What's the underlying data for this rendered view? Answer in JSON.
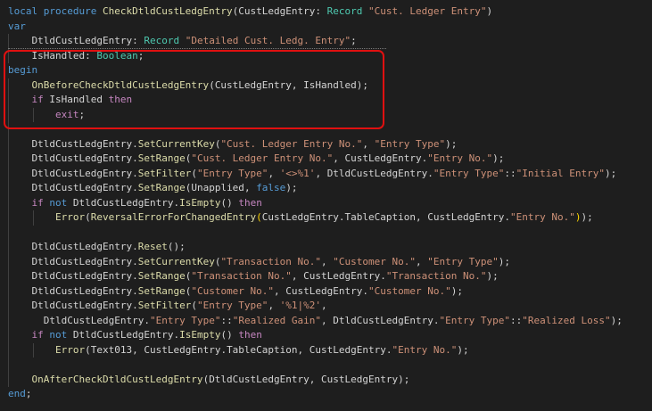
{
  "code": {
    "l01": {
      "a": "local procedure ",
      "b": "CheckDtldCustLedgEntry",
      "c": "(",
      "d": "CustLedgEntry",
      "e": ": ",
      "f": "Record",
      "g": " ",
      "h": "\"Cust. Ledger Entry\"",
      "i": ")"
    },
    "l02": {
      "a": "var"
    },
    "l03": {
      "a": "    ",
      "b": "DtldCustLedgEntry",
      "c": ": ",
      "d": "Record",
      "e": " ",
      "f": "\"Detailed Cust. Ledg. Entry\"",
      "g": ";"
    },
    "l04": {
      "a": "    ",
      "b": "IsHandled",
      "c": ": ",
      "d": "Boolean",
      "e": ";"
    },
    "l05": {
      "a": "begin"
    },
    "l06": {
      "a": "    ",
      "b": "OnBeforeCheckDtldCustLedgEntry",
      "c": "(",
      "d": "CustLedgEntry",
      "e": ", ",
      "f": "IsHandled",
      "g": ");"
    },
    "l07": {
      "a": "    ",
      "b": "if",
      "c": " ",
      "d": "IsHandled",
      "e": " ",
      "f": "then"
    },
    "l08": {
      "a": "        ",
      "b": "exit",
      "c": ";"
    },
    "l09": {
      "a": ""
    },
    "l10": {
      "a": "    ",
      "b": "DtldCustLedgEntry",
      "c": ".",
      "d": "SetCurrentKey",
      "e": "(",
      "f": "\"Cust. Ledger Entry No.\"",
      "g": ", ",
      "h": "\"Entry Type\"",
      "i": ");"
    },
    "l11": {
      "a": "    ",
      "b": "DtldCustLedgEntry",
      "c": ".",
      "d": "SetRange",
      "e": "(",
      "f": "\"Cust. Ledger Entry No.\"",
      "g": ", ",
      "h": "CustLedgEntry",
      "i": ".",
      "j": "\"Entry No.\"",
      "k": ");"
    },
    "l12": {
      "a": "    ",
      "b": "DtldCustLedgEntry",
      "c": ".",
      "d": "SetFilter",
      "e": "(",
      "f": "\"Entry Type\"",
      "g": ", ",
      "h": "'<>%1'",
      "i": ", ",
      "j": "DtldCustLedgEntry",
      "k": ".",
      "l": "\"Entry Type\"",
      "m": "::",
      "n": "\"Initial Entry\"",
      "o": ");"
    },
    "l13": {
      "a": "    ",
      "b": "DtldCustLedgEntry",
      "c": ".",
      "d": "SetRange",
      "e": "(",
      "f": "Unapplied",
      "g": ", ",
      "h": "false",
      "i": ");"
    },
    "l14": {
      "a": "    ",
      "b": "if",
      "c": " ",
      "d": "not",
      "e": " ",
      "f": "DtldCustLedgEntry",
      "g": ".",
      "h": "IsEmpty",
      "i": "() ",
      "j": "then"
    },
    "l15": {
      "a": "        ",
      "b": "Error",
      "c": "(",
      "d": "ReversalErrorForChangedEntry",
      "e": "(",
      "f": "CustLedgEntry",
      "g": ".",
      "h": "TableCaption",
      "i": ", ",
      "j": "CustLedgEntry",
      "k": ".",
      "l": "\"Entry No.\"",
      "m": ")",
      "n": ");"
    },
    "l16": {
      "a": ""
    },
    "l17": {
      "a": "    ",
      "b": "DtldCustLedgEntry",
      "c": ".",
      "d": "Reset",
      "e": "();"
    },
    "l18": {
      "a": "    ",
      "b": "DtldCustLedgEntry",
      "c": ".",
      "d": "SetCurrentKey",
      "e": "(",
      "f": "\"Transaction No.\"",
      "g": ", ",
      "h": "\"Customer No.\"",
      "i": ", ",
      "j": "\"Entry Type\"",
      "k": ");"
    },
    "l19": {
      "a": "    ",
      "b": "DtldCustLedgEntry",
      "c": ".",
      "d": "SetRange",
      "e": "(",
      "f": "\"Transaction No.\"",
      "g": ", ",
      "h": "CustLedgEntry",
      "i": ".",
      "j": "\"Transaction No.\"",
      "k": ");"
    },
    "l20": {
      "a": "    ",
      "b": "DtldCustLedgEntry",
      "c": ".",
      "d": "SetRange",
      "e": "(",
      "f": "\"Customer No.\"",
      "g": ", ",
      "h": "CustLedgEntry",
      "i": ".",
      "j": "\"Customer No.\"",
      "k": ");"
    },
    "l21": {
      "a": "    ",
      "b": "DtldCustLedgEntry",
      "c": ".",
      "d": "SetFilter",
      "e": "(",
      "f": "\"Entry Type\"",
      "g": ", ",
      "h": "'%1|%2'",
      "i": ","
    },
    "l22": {
      "a": "      ",
      "b": "DtldCustLedgEntry",
      "c": ".",
      "d": "\"Entry Type\"",
      "e": "::",
      "f": "\"Realized Gain\"",
      "g": ", ",
      "h": "DtldCustLedgEntry",
      "i": ".",
      "j": "\"Entry Type\"",
      "k": "::",
      "l": "\"Realized Loss\"",
      "m": ");"
    },
    "l23": {
      "a": "    ",
      "b": "if",
      "c": " ",
      "d": "not",
      "e": " ",
      "f": "DtldCustLedgEntry",
      "g": ".",
      "h": "IsEmpty",
      "i": "() ",
      "j": "then"
    },
    "l24": {
      "a": "        ",
      "b": "Error",
      "c": "(",
      "d": "Text013",
      "e": ", ",
      "f": "CustLedgEntry",
      "g": ".",
      "h": "TableCaption",
      "i": ", ",
      "j": "CustLedgEntry",
      "k": ".",
      "l": "\"Entry No.\"",
      "m": ");"
    },
    "l25": {
      "a": ""
    },
    "l26": {
      "a": "    ",
      "b": "OnAfterCheckDtldCustLedgEntry",
      "c": "(",
      "d": "DtldCustLedgEntry",
      "e": ", ",
      "f": "CustLedgEntry",
      "g": ");"
    },
    "l27": {
      "a": "end",
      "b": ";"
    }
  },
  "colors": {
    "background": "#1e1e1e",
    "keyword": "#569cd6",
    "control": "#c586c0",
    "type": "#4ec9b0",
    "string": "#ce9178",
    "function": "#dcdcaa",
    "text": "#d4d4d4",
    "highlight_border": "#e01010"
  }
}
